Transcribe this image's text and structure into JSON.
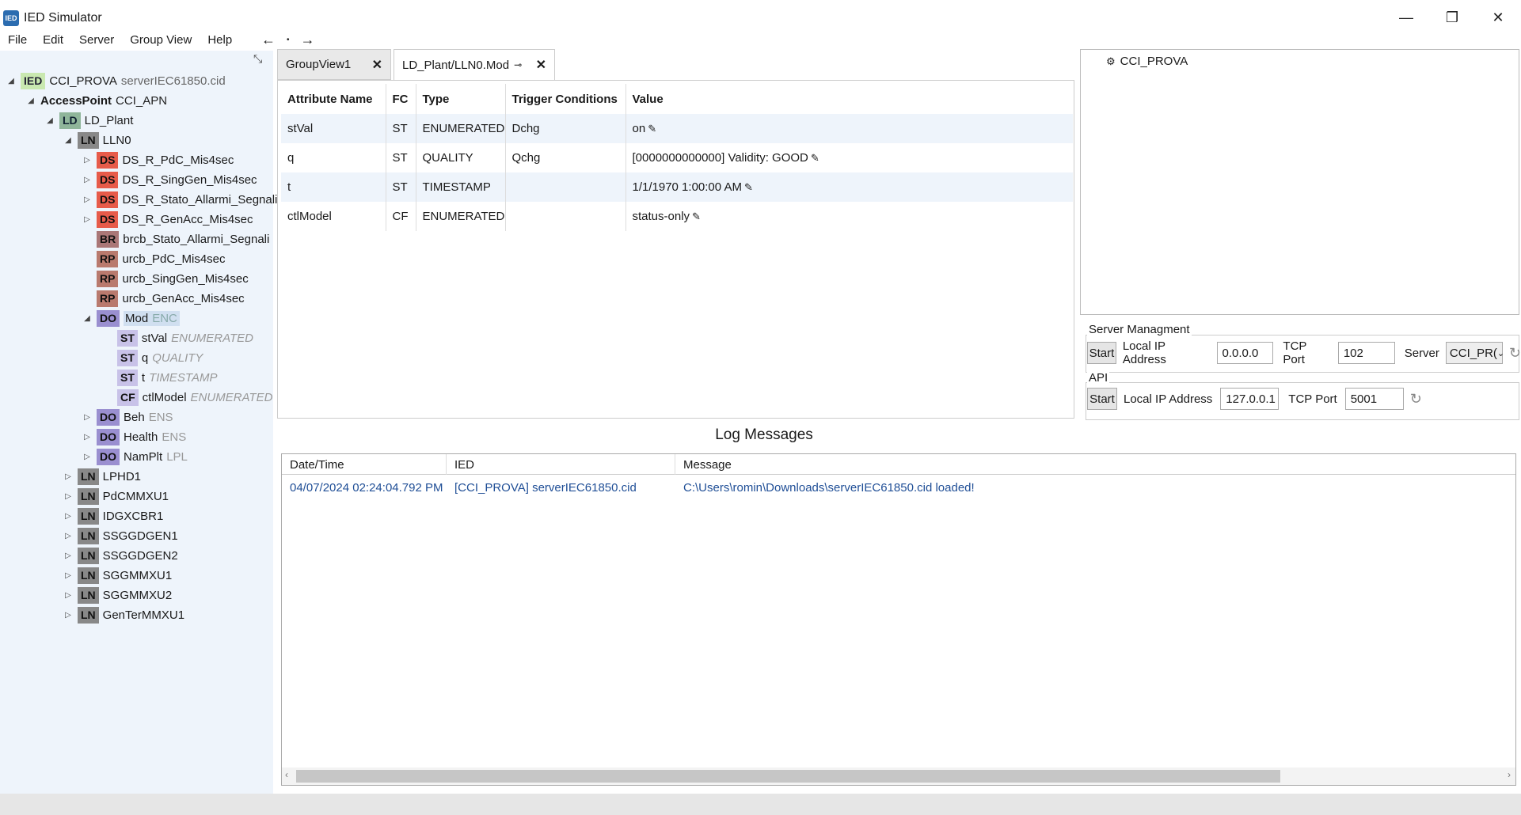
{
  "window": {
    "title": "IED Simulator"
  },
  "menu": [
    "File",
    "Edit",
    "Server",
    "Group View",
    "Help"
  ],
  "tree": {
    "ied": {
      "badge": "IED",
      "name": "CCI_PROVA",
      "sub": "serverIEC61850.cid"
    },
    "access_point": {
      "label": "AccessPoint",
      "name": "CCI_APN"
    },
    "ld": {
      "badge": "LD",
      "name": "LD_Plant"
    },
    "lln0": {
      "badge": "LN",
      "name": "LLN0"
    },
    "ds": [
      {
        "badge": "DS",
        "name": "DS_R_PdC_Mis4sec"
      },
      {
        "badge": "DS",
        "name": "DS_R_SingGen_Mis4sec"
      },
      {
        "badge": "DS",
        "name": "DS_R_Stato_Allarmi_Segnali"
      },
      {
        "badge": "DS",
        "name": "DS_R_GenAcc_Mis4sec"
      }
    ],
    "br": {
      "badge": "BR",
      "name": "brcb_Stato_Allarmi_Segnali"
    },
    "rp": [
      {
        "badge": "RP",
        "name": "urcb_PdC_Mis4sec"
      },
      {
        "badge": "RP",
        "name": "urcb_SingGen_Mis4sec"
      },
      {
        "badge": "RP",
        "name": "urcb_GenAcc_Mis4sec"
      }
    ],
    "mod": {
      "badge": "DO",
      "name": "Mod",
      "sub": "ENC"
    },
    "mod_attrs": [
      {
        "badge": "ST",
        "name": "stVal",
        "sub": "ENUMERATED"
      },
      {
        "badge": "ST",
        "name": "q",
        "sub": "QUALITY"
      },
      {
        "badge": "ST",
        "name": "t",
        "sub": "TIMESTAMP"
      },
      {
        "badge": "CF",
        "name": "ctlModel",
        "sub": "ENUMERATED"
      }
    ],
    "dos": [
      {
        "badge": "DO",
        "name": "Beh",
        "sub": "ENS"
      },
      {
        "badge": "DO",
        "name": "Health",
        "sub": "ENS"
      },
      {
        "badge": "DO",
        "name": "NamPlt",
        "sub": "LPL"
      }
    ],
    "lns": [
      {
        "badge": "LN",
        "name": "LPHD1"
      },
      {
        "badge": "LN",
        "name": "PdCMMXU1"
      },
      {
        "badge": "LN",
        "name": "IDGXCBR1"
      },
      {
        "badge": "LN",
        "name": "SSGGDGEN1"
      },
      {
        "badge": "LN",
        "name": "SSGGDGEN2"
      },
      {
        "badge": "LN",
        "name": "SGGMMXU1"
      },
      {
        "badge": "LN",
        "name": "SGGMMXU2"
      },
      {
        "badge": "LN",
        "name": "GenTerMMXU1"
      }
    ]
  },
  "tabs": [
    {
      "label": "GroupView1",
      "close": "✕"
    },
    {
      "label": "LD_Plant/LLN0.Mod",
      "close": "✕",
      "pin": "⊸"
    }
  ],
  "attr_table": {
    "headers": [
      "Attribute Name",
      "FC",
      "Type",
      "Trigger Conditions",
      "Value"
    ],
    "rows": [
      {
        "name": "stVal",
        "fc": "ST",
        "type": "ENUMERATED",
        "trigger": "Dchg",
        "value": "on"
      },
      {
        "name": "q",
        "fc": "ST",
        "type": "QUALITY",
        "trigger": "Qchg",
        "value": "[0000000000000] Validity: GOOD"
      },
      {
        "name": "t",
        "fc": "ST",
        "type": "TIMESTAMP",
        "trigger": "",
        "value": "1/1/1970 1:00:00 AM"
      },
      {
        "name": "ctlModel",
        "fc": "CF",
        "type": "ENUMERATED",
        "trigger": "",
        "value": "status-only"
      }
    ]
  },
  "right_tree": {
    "item": "CCI_PROVA"
  },
  "server_mgmt": {
    "title": "Server Managment",
    "start": "Start",
    "ip_label": "Local IP Address",
    "ip": "0.0.0.0",
    "port_label": "TCP Port",
    "port": "102",
    "server_label": "Server",
    "server": "CCI_PR("
  },
  "api": {
    "title": "API",
    "start": "Start",
    "ip_label": "Local IP Address",
    "ip": "127.0.0.1",
    "port_label": "TCP Port",
    "port": "5001"
  },
  "log": {
    "title": "Log Messages",
    "headers": [
      "Date/Time",
      "IED",
      "Message"
    ],
    "rows": [
      {
        "datetime": "04/07/2024 02:24:04.792 PM",
        "ied": "[CCI_PROVA] serverIEC61850.cid",
        "message": "C:\\Users\\romin\\Downloads\\serverIEC61850.cid loaded!"
      }
    ]
  },
  "colors": {
    "tree_bg": "#eef4fb",
    "accent": "#1f4e96",
    "ds_badge": "#e75b4a",
    "do_badge": "#9a8fd0"
  }
}
